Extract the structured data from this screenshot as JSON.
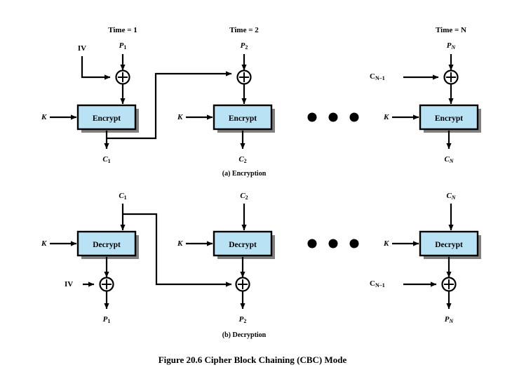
{
  "figure": {
    "caption": "Figure 20.6 Cipher Block Chaining (CBC) Mode",
    "sections": [
      {
        "id": "encryption",
        "label": "(a) Encryption"
      },
      {
        "id": "decryption",
        "label": "(b) Decryption"
      }
    ]
  },
  "colors": {
    "box_fill": "#b9e3f4",
    "box_border": "#000000",
    "box_shadow": "#808080",
    "line": "#000000",
    "background": "#ffffff",
    "text": "#000000"
  },
  "encryption": {
    "time_labels": [
      "Time = 1",
      "Time = 2",
      "Time = N"
    ],
    "ellipsis": "• • •",
    "blocks": [
      {
        "index": 1,
        "time_label": "Time = 1",
        "plaintext_in": "P1",
        "plaintext_in_base": "P",
        "plaintext_in_sub": "1",
        "xor_feed_label": "IV",
        "key_label": "K",
        "operation": "Encrypt",
        "ciphertext_out": "C1",
        "ciphertext_out_base": "C",
        "ciphertext_out_sub": "1"
      },
      {
        "index": 2,
        "time_label": "Time = 2",
        "plaintext_in": "P2",
        "plaintext_in_base": "P",
        "plaintext_in_sub": "2",
        "xor_feed_label": "",
        "key_label": "K",
        "operation": "Encrypt",
        "ciphertext_out": "C2",
        "ciphertext_out_base": "C",
        "ciphertext_out_sub": "2"
      },
      {
        "index": 3,
        "time_label": "Time = N",
        "plaintext_in": "PN",
        "plaintext_in_base": "P",
        "plaintext_in_sub": "N",
        "xor_feed_label": "CN-1",
        "xor_feed_base": "C",
        "xor_feed_sub": "N–1",
        "key_label": "K",
        "operation": "Encrypt",
        "ciphertext_out": "CN",
        "ciphertext_out_base": "C",
        "ciphertext_out_sub": "N"
      }
    ]
  },
  "decryption": {
    "ellipsis": "• • •",
    "blocks": [
      {
        "index": 1,
        "ciphertext_in": "C1",
        "ciphertext_in_base": "C",
        "ciphertext_in_sub": "1",
        "key_label": "K",
        "operation": "Decrypt",
        "xor_feed_label": "IV",
        "plaintext_out": "P1",
        "plaintext_out_base": "P",
        "plaintext_out_sub": "1"
      },
      {
        "index": 2,
        "ciphertext_in": "C2",
        "ciphertext_in_base": "C",
        "ciphertext_in_sub": "2",
        "key_label": "K",
        "operation": "Decrypt",
        "xor_feed_label": "",
        "plaintext_out": "P2",
        "plaintext_out_base": "P",
        "plaintext_out_sub": "2"
      },
      {
        "index": 3,
        "ciphertext_in": "CN",
        "ciphertext_in_base": "C",
        "ciphertext_in_sub": "N",
        "key_label": "K",
        "operation": "Decrypt",
        "xor_feed_label": "CN-1",
        "xor_feed_base": "C",
        "xor_feed_sub": "N–1",
        "plaintext_out": "PN",
        "plaintext_out_base": "P",
        "plaintext_out_sub": "N"
      }
    ]
  },
  "symbols": {
    "xor": "+",
    "ellipsis_dot": "•"
  }
}
